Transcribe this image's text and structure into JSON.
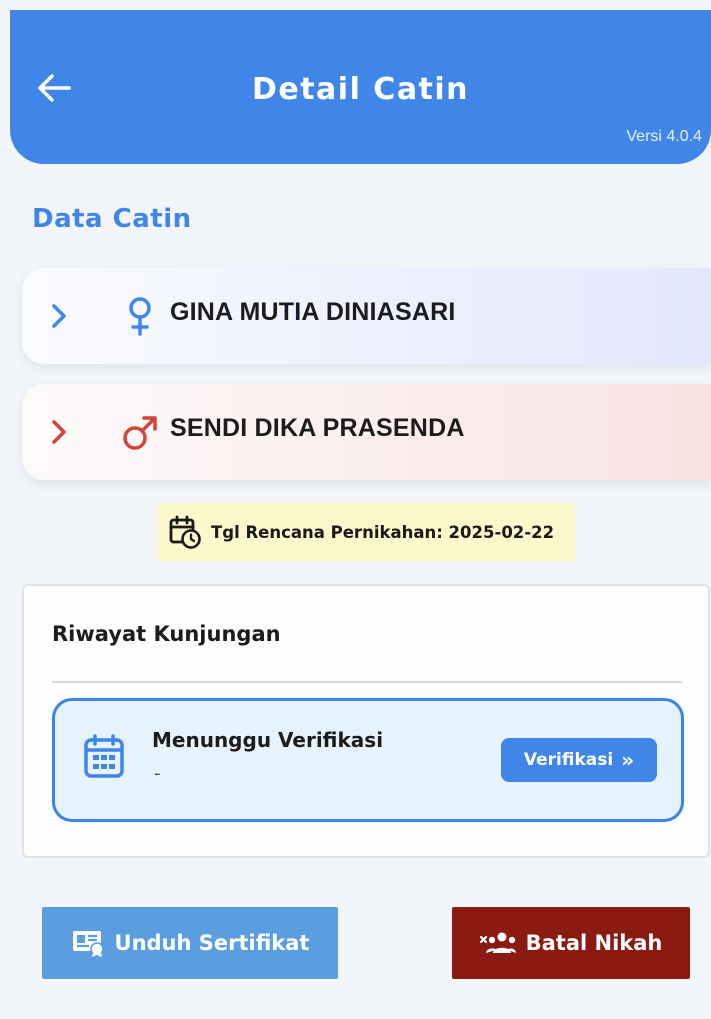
{
  "header": {
    "title": "Detail Catin",
    "version": "Versi 4.0.4",
    "background_color": "#3f86e8"
  },
  "section": {
    "title": "Data Catin"
  },
  "persons": [
    {
      "name": "GINA MUTIA DINIASARI",
      "gender": "female",
      "icon": "female-icon",
      "accent_color": "#3f86e8"
    },
    {
      "name": "SENDI DIKA PRASENDA",
      "gender": "male",
      "icon": "male-icon",
      "accent_color": "#d0463a"
    }
  ],
  "wedding_plan": {
    "text": "Tgl Rencana Pernikahan: 2025-02-22",
    "icon": "calendar-clock-icon"
  },
  "history": {
    "title": "Riwayat Kunjungan",
    "visits": [
      {
        "status": "Menunggu Verifikasi",
        "detail": "-",
        "icon": "calendar-icon",
        "action_label": "Verifikasi",
        "action_icon": "double-chevron-right-icon"
      }
    ]
  },
  "actions": {
    "certificate": {
      "label": "Unduh Sertifikat",
      "icon": "certificate-icon",
      "color": "#5b9ee0"
    },
    "cancel": {
      "label": "Batal Nikah",
      "icon": "cancel-group-icon",
      "color": "#8b1a12"
    }
  }
}
